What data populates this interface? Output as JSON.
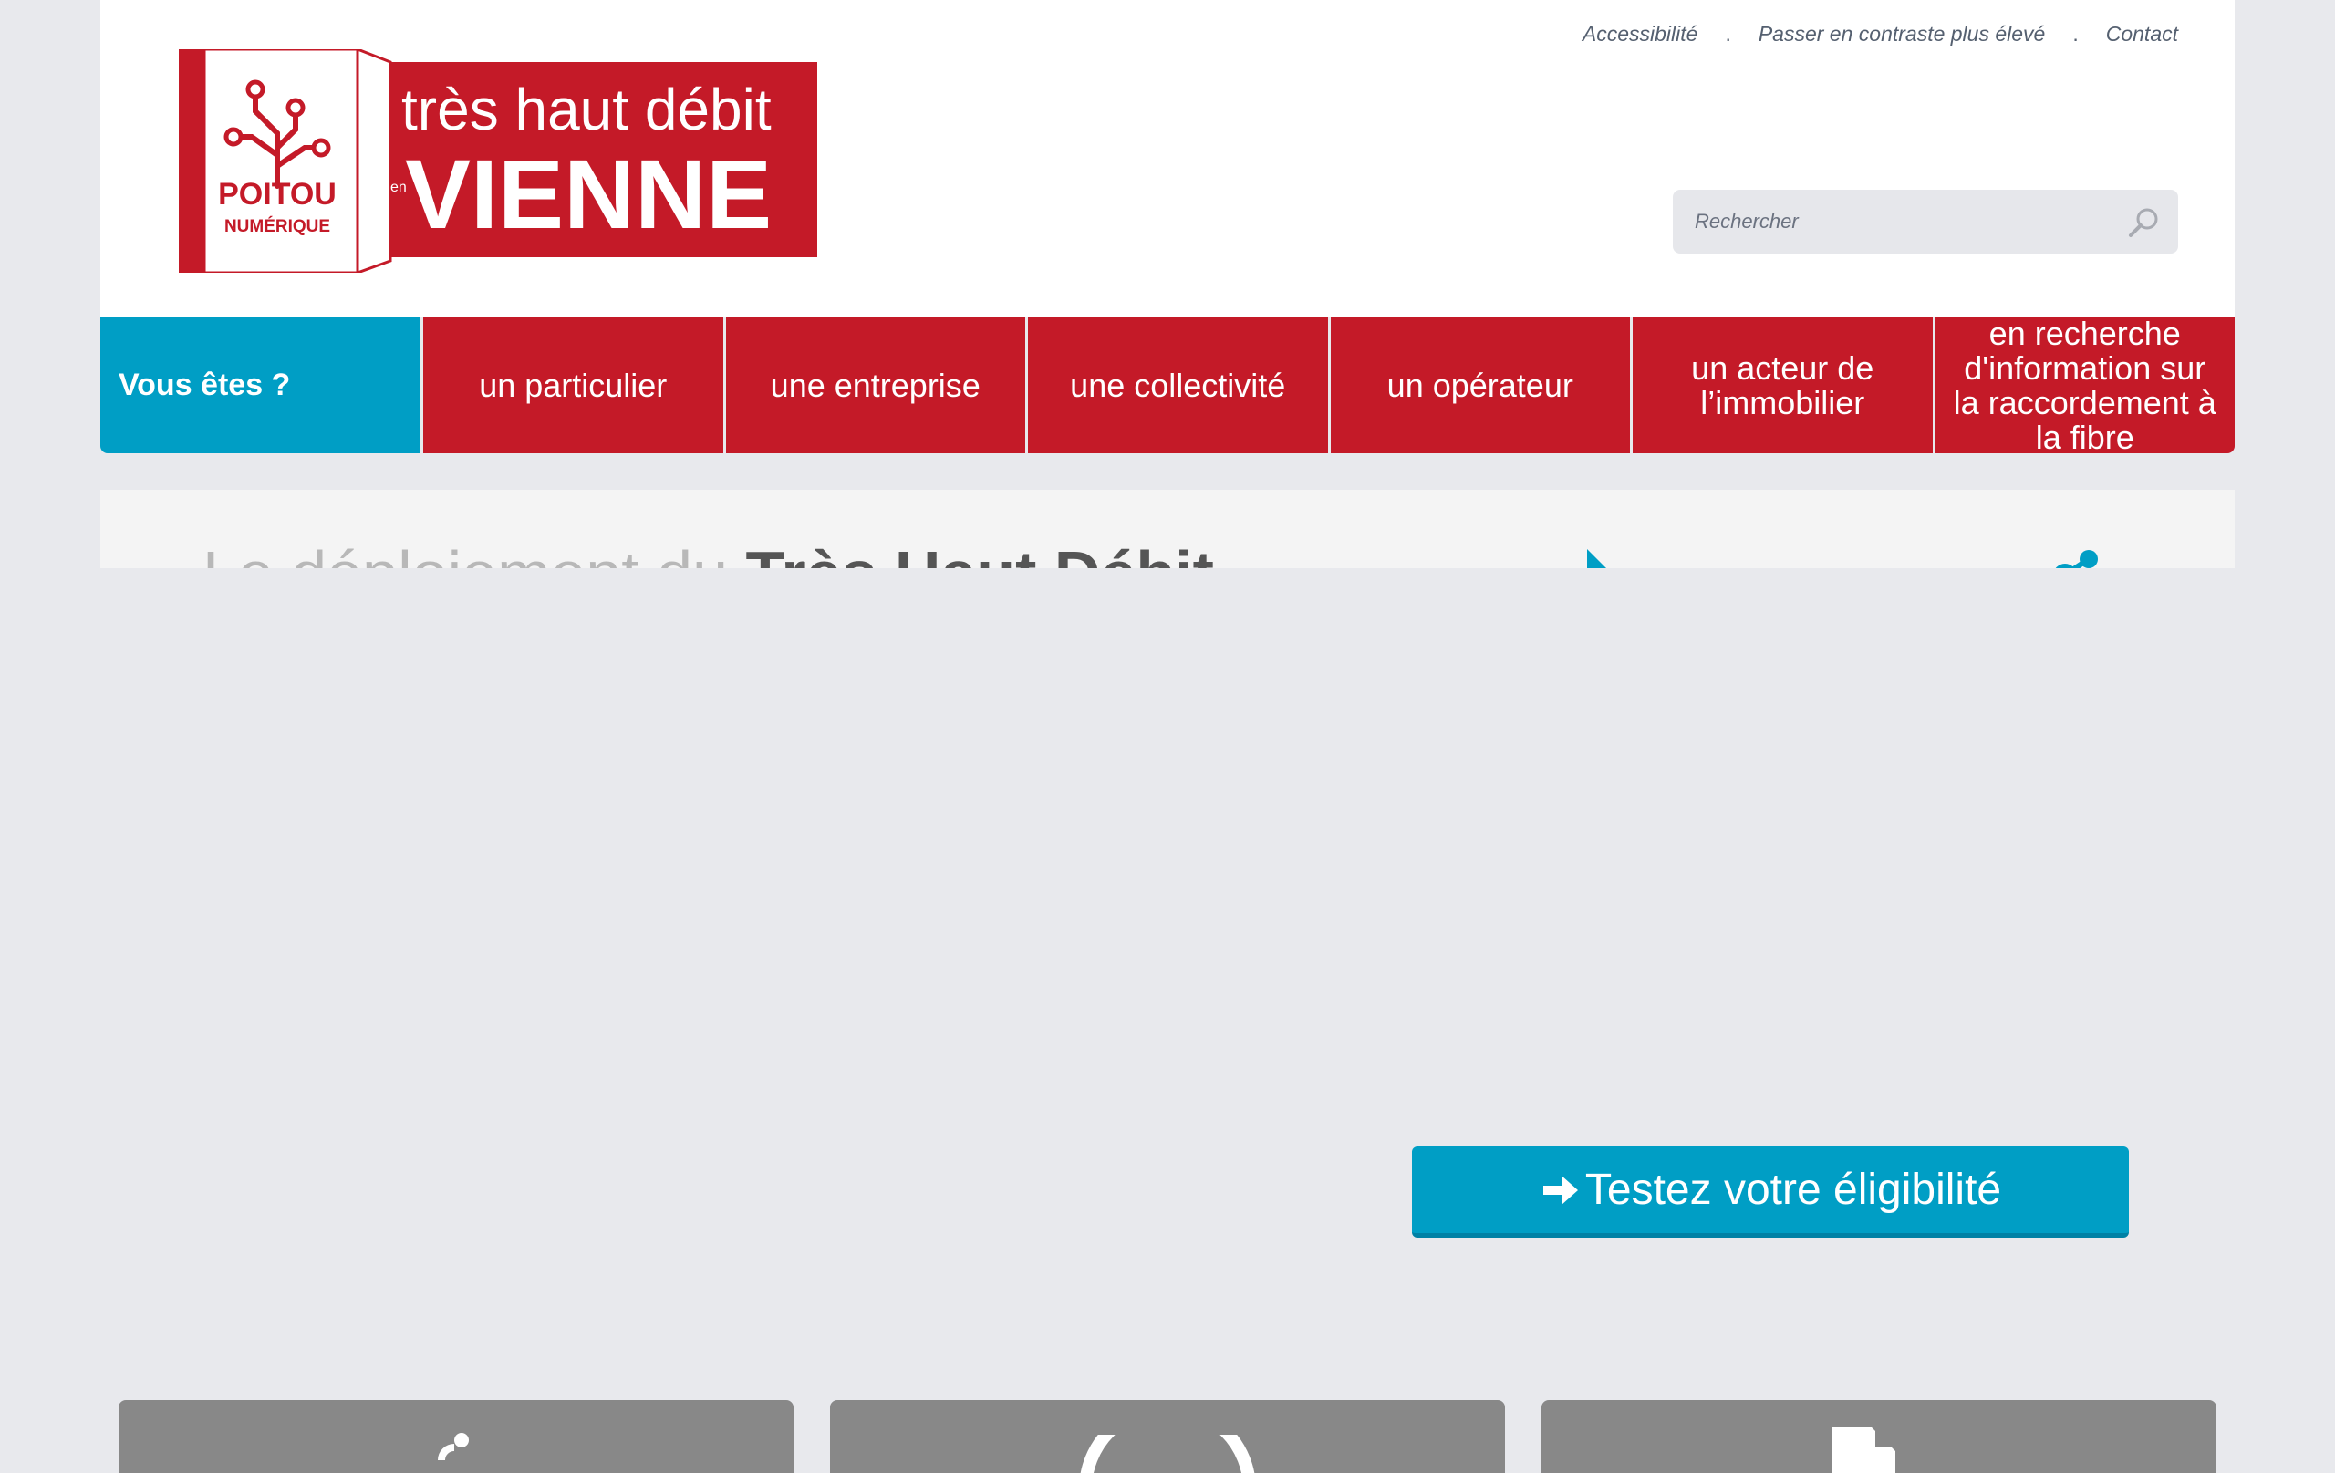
{
  "toplinks": {
    "accessibility": "Accessibilité",
    "contrast": "Passer en contraste plus élevé",
    "contact": "Contact",
    "separator": "."
  },
  "logo": {
    "brand_line1": "POITOU",
    "brand_line2": "NUMÉRIQUE",
    "title_line1": "très haut débit",
    "title_en": "en",
    "title_line2": "VIENNE"
  },
  "search": {
    "placeholder": "Rechercher"
  },
  "nav": {
    "who_label": "Vous êtes ?",
    "items": [
      {
        "label": "un particulier"
      },
      {
        "label": "une entreprise"
      },
      {
        "label": "une collectivité"
      },
      {
        "label": "un opérateur"
      },
      {
        "label": "un acteur de l’immobilier"
      },
      {
        "label": "en recherche d'information sur la raccordement à la fibre"
      }
    ]
  },
  "hero": {
    "title_light": "Le déploiement du ",
    "title_bold": "Très Haut Débit"
  },
  "cta": {
    "label": "Testez votre éligibilité"
  },
  "colors": {
    "brand_red": "#c41a28",
    "accent_blue": "#009ec5",
    "card_gray": "#888888",
    "page_bg": "#e8e9ed"
  },
  "icons": [
    "search-icon",
    "play-icon",
    "share-icon",
    "arrow-right-icon",
    "speed-icon",
    "document-icon"
  ]
}
